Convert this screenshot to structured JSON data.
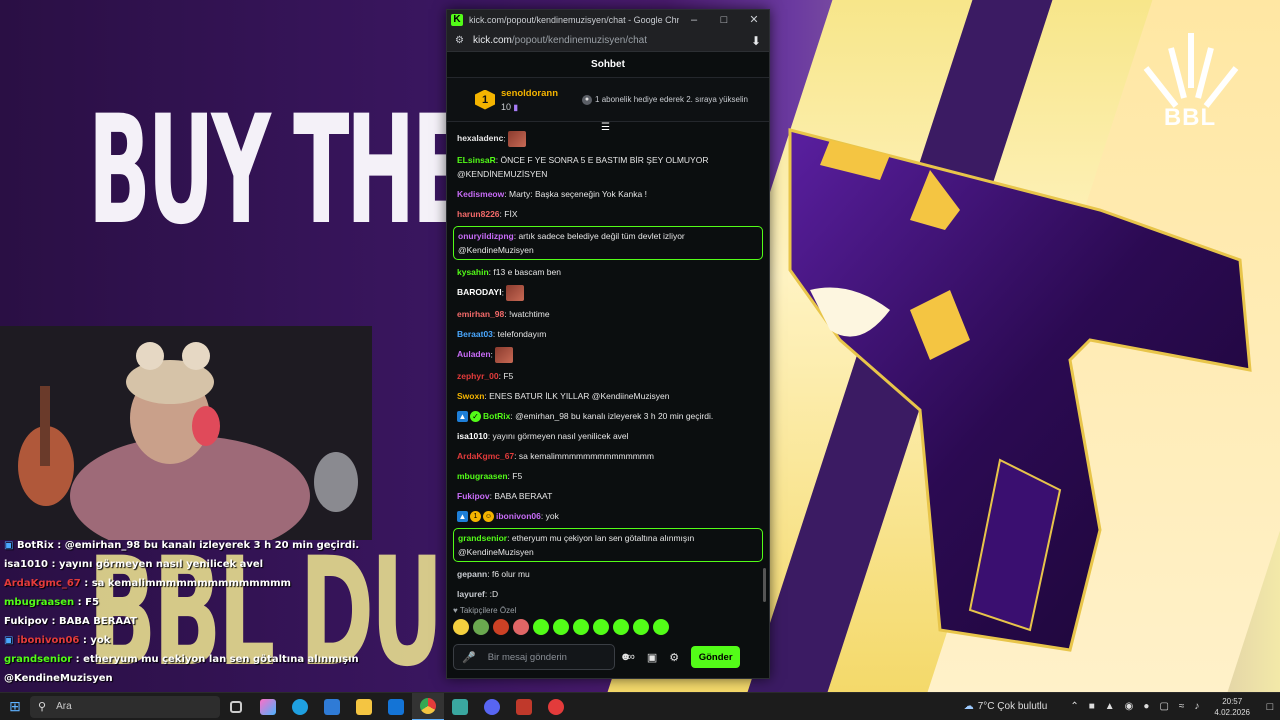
{
  "colors": {
    "kick_green": "#53fc18",
    "gold": "#f4b400",
    "purple": "#a77cf7"
  },
  "stream": {
    "headline": "BUY THE",
    "headline_bottom": "BBL DU",
    "brand": "BBL"
  },
  "overlay_chat": [
    {
      "user": "BotRix",
      "text": "@emirhan_98 bu kanalı izleyerek 3 h 20 min geçirdi.",
      "color": "#ffffff",
      "badges": "bot-verified"
    },
    {
      "user": "isa1010",
      "text": "yayını görmeyen nasıl yenilicek avel",
      "color": "#ffffff"
    },
    {
      "user": "ArdaKgmc_67",
      "text": "sa kemalimmmmmmmmmmmmmm",
      "color": "#e33b3b"
    },
    {
      "user": "mbugraasen",
      "text": "F5",
      "color": "#53fc18"
    },
    {
      "user": "Fukipov",
      "text": "BABA BERAAT",
      "color": "#ffffff"
    },
    {
      "user": "ibonivon06",
      "text": "yok",
      "color": "#e33b3b",
      "badges": "bot-gold"
    },
    {
      "user": "grandsenior",
      "text": "etheryum mu çekiyon lan sen götaltına alınmışın",
      "color": "#53fc18"
    },
    {
      "user": "",
      "text": "@KendineMuzisyen",
      "color": "#ffffff"
    },
    {
      "user": "gepann",
      "text": "f6 olur mu",
      "color": "#ffffff"
    }
  ],
  "browser": {
    "title": "kick.com/popout/kendinemuzisyen/chat - Google Chrome",
    "favicon": "K",
    "url_host": "kick.com",
    "url_path": "/popout/kendinemuzisyen/chat",
    "tabs_icon": "site-info-icon",
    "download_icon": "download-icon"
  },
  "chat": {
    "header": "Sohbet",
    "leaderboard": {
      "rank": "1",
      "user": "senoldorann",
      "count": "10",
      "message": "1 abonelik hediye ederek 2. sıraya yükselin"
    },
    "messages": [
      {
        "user": "hexaladenc",
        "text": "",
        "color": "#e6e6e6",
        "emote": true
      },
      {
        "user": "ELsinsaR",
        "text": "ÖNCE F YE SONRA 5 E BASTIM BİR ŞEY OLMUYOR @KENDİNEMUZİSYEN",
        "color": "#53fc18"
      },
      {
        "user": "Kedismeow",
        "text": "Marty: Başka seçeneğin Yok Kanka !",
        "color": "#c86cf7"
      },
      {
        "user": "harun8226",
        "text": "FİX",
        "color": "#f46a6a"
      },
      {
        "user": "onuryildizpng",
        "text": "artık sadece belediye değil tüm devlet izliyor @KendineMuzisyen",
        "color": "#c86cf7",
        "highlight": true
      },
      {
        "user": "kysahin",
        "text": "f13 e bascam ben",
        "color": "#53fc18"
      },
      {
        "user": "BARODAYI",
        "text": "",
        "color": "#ffffff",
        "emote": true
      },
      {
        "user": "emirhan_98",
        "text": "!watchtime",
        "color": "#f46a6a"
      },
      {
        "user": "Beraat03",
        "text": "telefondayım",
        "color": "#4aa8ff"
      },
      {
        "user": "Auladen",
        "text": "",
        "color": "#c86cf7",
        "emote": true
      },
      {
        "user": "zephyr_00",
        "text": "F5",
        "color": "#e33b3b"
      },
      {
        "user": "Swoxn",
        "text": "ENES BATUR İLK YILLAR @KendiineMuzisyen",
        "color": "#f4b400"
      },
      {
        "user": "BotRix",
        "text": "@emirhan_98 bu kanalı izleyerek 3 h 20 min geçirdi.",
        "color": "#53fc18",
        "badges": "bot-verified"
      },
      {
        "user": "isa1010",
        "text": "yayını görmeyen nasıl yenilicek avel",
        "color": "#ffffff"
      },
      {
        "user": "ArdaKgmc_67",
        "text": "sa kemalimmmmmmmmmmmmmm",
        "color": "#e33b3b"
      },
      {
        "user": "mbugraasen",
        "text": "F5",
        "color": "#53fc18"
      },
      {
        "user": "Fukipov",
        "text": "BABA BERAAT",
        "color": "#c86cf7"
      },
      {
        "user": "ibonivon06",
        "text": "yok",
        "color": "#c86cf7",
        "badges": "bot-gold"
      },
      {
        "user": "grandsenior",
        "text": "etheryum mu çekiyon lan sen götaltına alınmışın @KendineMuzisyen",
        "color": "#53fc18",
        "highlight": true
      },
      {
        "user": "gepann",
        "text": "f6 olur mu",
        "color": "#c9ccd1"
      },
      {
        "user": "layuref",
        "text": ":D",
        "color": "#c9ccd1"
      }
    ],
    "emote_section_title": "Takipçilere Özel",
    "emote_colors": [
      "#f4d03f",
      "#6aa84f",
      "#cc4125",
      "#e06666",
      "#53fc18",
      "#53fc18",
      "#53fc18",
      "#53fc18",
      "#53fc18",
      "#53fc18",
      "#53fc18"
    ],
    "input_placeholder": "Bir mesaj gönderin",
    "send_label": "Gönder"
  },
  "taskbar": {
    "search_placeholder": "Ara",
    "weather": "7°C  Çok bulutlu",
    "time": "20:57",
    "date": "4.02.2026"
  }
}
